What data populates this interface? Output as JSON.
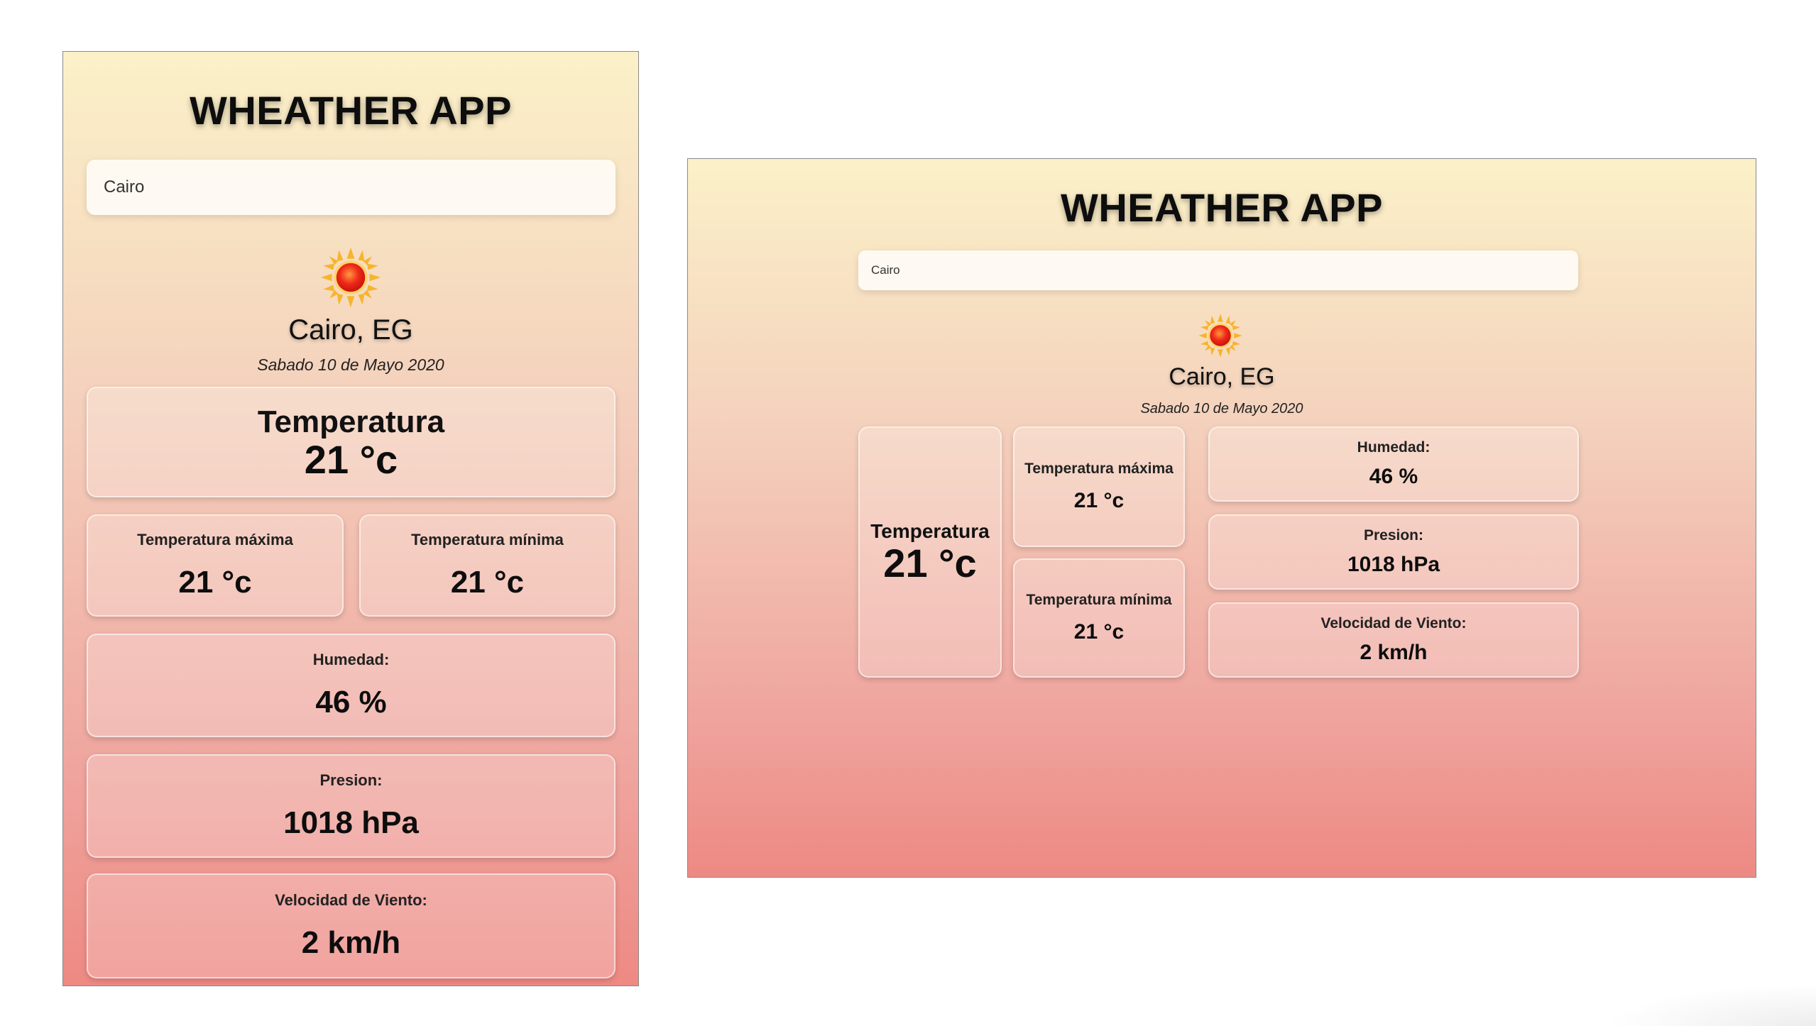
{
  "app": {
    "title": "WHEATHER APP",
    "search_value": "Cairo",
    "weather_icon": "sun-icon",
    "location": "Cairo, EG",
    "date": "Sabado 10 de Mayo 2020"
  },
  "stats": {
    "temperature": {
      "label": "Temperatura",
      "value": "21 °c"
    },
    "temp_max": {
      "label": "Temperatura máxima",
      "value": "21 °c"
    },
    "temp_min": {
      "label": "Temperatura mínima",
      "value": "21 °c"
    },
    "humidity": {
      "label": "Humedad:",
      "value": "46 %"
    },
    "pressure": {
      "label": "Presion:",
      "value": "1018 hPa"
    },
    "wind": {
      "label": "Velocidad de Viento:",
      "value": "2 km/h"
    }
  },
  "colors": {
    "gradient_top": "#fbf1c8",
    "gradient_bottom": "#ee8983",
    "sun_core": "#f0281a",
    "sun_rays": "#f7b42c"
  }
}
